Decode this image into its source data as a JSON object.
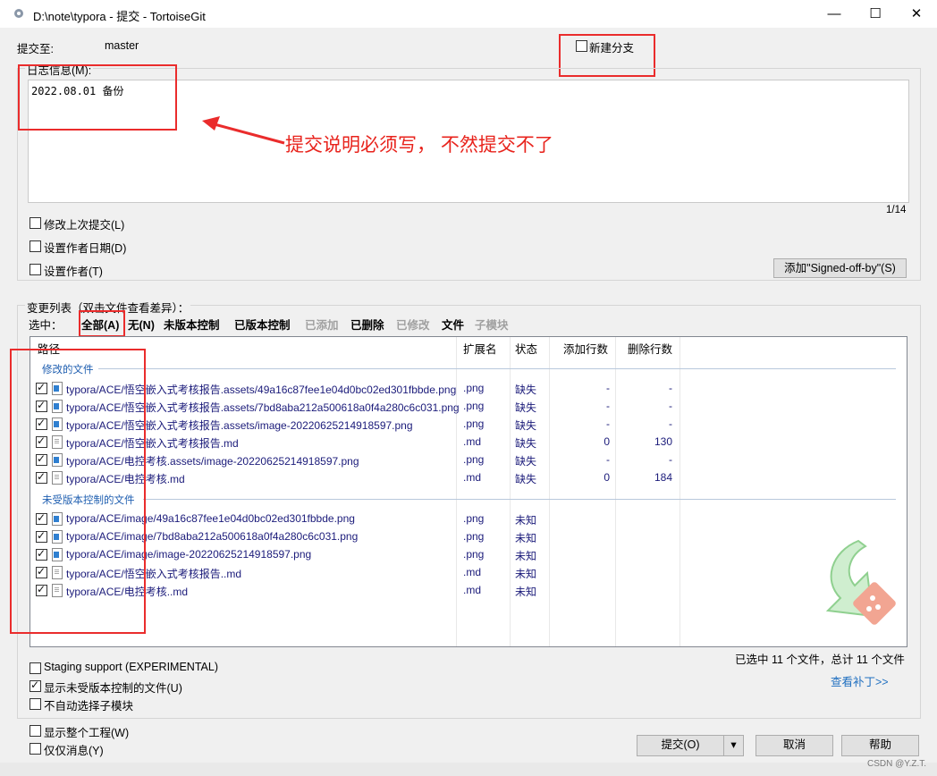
{
  "window": {
    "title": "D:\\note\\typora - 提交 - TortoiseGit",
    "controls": [
      "—",
      "☐",
      "✕"
    ]
  },
  "commit_to": {
    "label": "提交至:",
    "branch": "master"
  },
  "new_branch": {
    "label": "新建分支",
    "checked": false
  },
  "message": {
    "group_label": "日志信息(M):",
    "text": "2022.08.01 备份",
    "counter": "1/14"
  },
  "options_top": [
    {
      "label": "修改上次提交(L)",
      "checked": false
    },
    {
      "label": "设置作者日期(D)",
      "checked": false
    },
    {
      "label": "设置作者(T)",
      "checked": false
    }
  ],
  "signed_off_button": "添加\"Signed-off-by\"(S)",
  "annotation": "提交说明必须写， 不然提交不了",
  "changes": {
    "group_label": "变更列表（双击文件查看差异）：",
    "select_label": "选中：",
    "filters": [
      {
        "label": "全部(A)",
        "enabled": true
      },
      {
        "label": "无(N)",
        "enabled": true
      },
      {
        "label": "未版本控制",
        "enabled": true
      },
      {
        "label": "已版本控制",
        "enabled": true
      },
      {
        "label": "已添加",
        "enabled": false
      },
      {
        "label": "已删除",
        "enabled": true
      },
      {
        "label": "已修改",
        "enabled": false
      },
      {
        "label": "文件",
        "enabled": true
      },
      {
        "label": "子模块",
        "enabled": false
      }
    ],
    "columns": [
      "路径",
      "扩展名",
      "状态",
      "添加行数",
      "删除行数"
    ],
    "groups": [
      {
        "name": "修改的文件",
        "files": [
          {
            "path": "typora/ACE/悟空嵌入式考核报告.assets/49a16c87fee1e04d0bc02ed301fbbde.png",
            "ext": ".png",
            "status": "缺失",
            "added": "-",
            "deleted": "-",
            "icon": "png",
            "checked": true
          },
          {
            "path": "typora/ACE/悟空嵌入式考核报告.assets/7bd8aba212a500618a0f4a280c6c031.png",
            "ext": ".png",
            "status": "缺失",
            "added": "-",
            "deleted": "-",
            "icon": "png",
            "checked": true
          },
          {
            "path": "typora/ACE/悟空嵌入式考核报告.assets/image-20220625214918597.png",
            "ext": ".png",
            "status": "缺失",
            "added": "-",
            "deleted": "-",
            "icon": "png",
            "checked": true
          },
          {
            "path": "typora/ACE/悟空嵌入式考核报告.md",
            "ext": ".md",
            "status": "缺失",
            "added": "0",
            "deleted": "130",
            "icon": "md",
            "checked": true
          },
          {
            "path": "typora/ACE/电控考核.assets/image-20220625214918597.png",
            "ext": ".png",
            "status": "缺失",
            "added": "-",
            "deleted": "-",
            "icon": "png",
            "checked": true
          },
          {
            "path": "typora/ACE/电控考核.md",
            "ext": ".md",
            "status": "缺失",
            "added": "0",
            "deleted": "184",
            "icon": "md",
            "checked": true
          }
        ]
      },
      {
        "name": "未受版本控制的文件",
        "files": [
          {
            "path": "typora/ACE/image/49a16c87fee1e04d0bc02ed301fbbde.png",
            "ext": ".png",
            "status": "未知",
            "added": "",
            "deleted": "",
            "icon": "png",
            "checked": true
          },
          {
            "path": "typora/ACE/image/7bd8aba212a500618a0f4a280c6c031.png",
            "ext": ".png",
            "status": "未知",
            "added": "",
            "deleted": "",
            "icon": "png",
            "checked": true
          },
          {
            "path": "typora/ACE/image/image-20220625214918597.png",
            "ext": ".png",
            "status": "未知",
            "added": "",
            "deleted": "",
            "icon": "png",
            "checked": true
          },
          {
            "path": "typora/ACE/悟空嵌入式考核报告..md",
            "ext": ".md",
            "status": "未知",
            "added": "",
            "deleted": "",
            "icon": "md",
            "checked": true
          },
          {
            "path": "typora/ACE/电控考核..md",
            "ext": ".md",
            "status": "未知",
            "added": "",
            "deleted": "",
            "icon": "md",
            "checked": true
          }
        ]
      }
    ],
    "selection_summary": "已选中 11 个文件，总计 11 个文件",
    "view_patch": "查看补丁>>"
  },
  "options_bottom": [
    {
      "label": "Staging support (EXPERIMENTAL)",
      "checked": false
    },
    {
      "label": "显示未受版本控制的文件(U)",
      "checked": true
    },
    {
      "label": "不自动选择子模块",
      "checked": false
    }
  ],
  "options_footer": [
    {
      "label": "显示整个工程(W)",
      "checked": false
    },
    {
      "label": "仅仅消息(Y)",
      "checked": false
    }
  ],
  "buttons": {
    "commit": "提交(O)",
    "dropdown": "▾",
    "cancel": "取消",
    "help": "帮助"
  },
  "watermark": "CSDN @Y.Z.T.",
  "colors": {
    "annotation_red": "#ea2c2c",
    "link_blue": "#1f6fc0",
    "file_text": "#1b1b7a",
    "group_header": "#1e5eb0"
  }
}
